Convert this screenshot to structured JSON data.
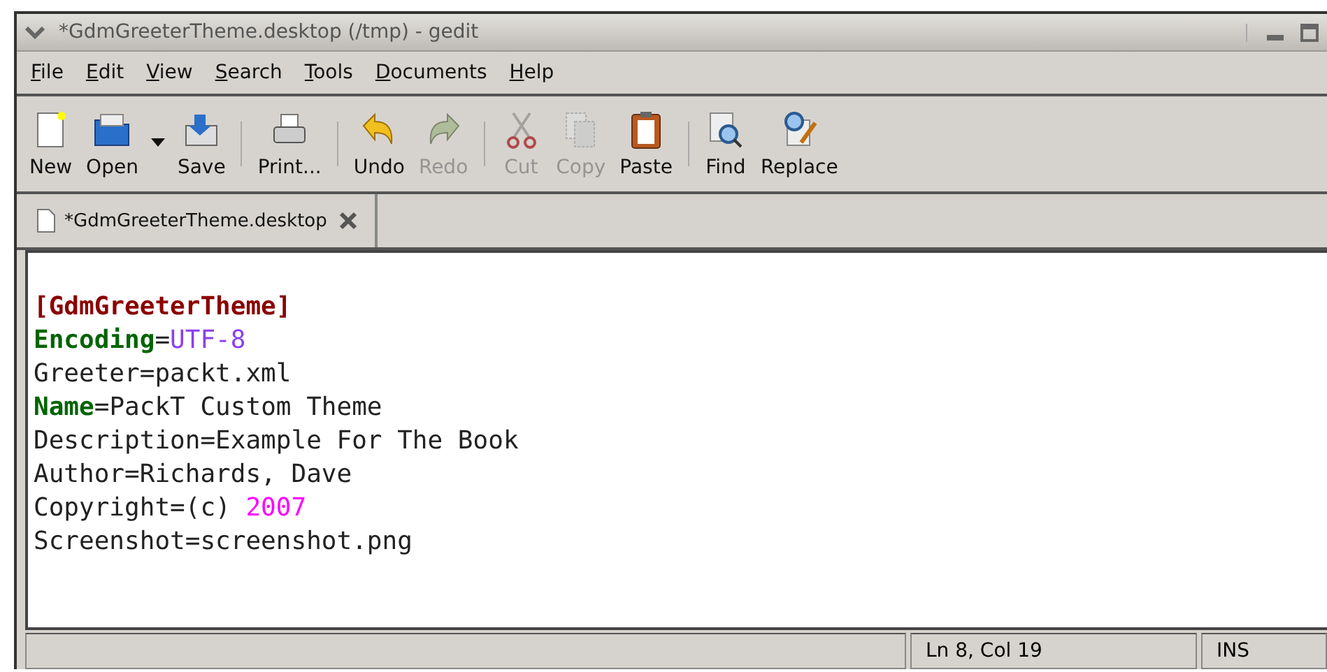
{
  "window": {
    "title": "*GdmGreeterTheme.desktop (/tmp) - gedit"
  },
  "menu": [
    "File",
    "Edit",
    "View",
    "Search",
    "Tools",
    "Documents",
    "Help"
  ],
  "toolbar": [
    [
      {
        "kind": "new",
        "label": "New",
        "disabled": false
      },
      {
        "kind": "open",
        "label": "Open",
        "disabled": false,
        "dropdown": true
      },
      {
        "kind": "save",
        "label": "Save",
        "disabled": false
      }
    ],
    [
      {
        "kind": "print",
        "label": "Print...",
        "disabled": false
      }
    ],
    [
      {
        "kind": "undo",
        "label": "Undo",
        "disabled": false
      },
      {
        "kind": "redo",
        "label": "Redo",
        "disabled": true
      }
    ],
    [
      {
        "kind": "cut",
        "label": "Cut",
        "disabled": true
      },
      {
        "kind": "copy",
        "label": "Copy",
        "disabled": true
      },
      {
        "kind": "paste",
        "label": "Paste",
        "disabled": false
      }
    ],
    [
      {
        "kind": "find",
        "label": "Find",
        "disabled": false
      },
      {
        "kind": "replace",
        "label": "Replace",
        "disabled": false
      }
    ]
  ],
  "tabs": [
    {
      "label": "*GdmGreeterTheme.desktop",
      "selected": true
    }
  ],
  "editor": {
    "lines": [
      [
        {
          "kind": "section",
          "text": "[GdmGreeterTheme]"
        }
      ],
      [
        {
          "kind": "key",
          "text": "Encoding"
        },
        {
          "kind": "plain",
          "text": "="
        },
        {
          "kind": "value",
          "text": "UTF-8"
        }
      ],
      [
        {
          "kind": "plain",
          "text": "Greeter=packt.xml"
        }
      ],
      [
        {
          "kind": "key",
          "text": "Name"
        },
        {
          "kind": "plain",
          "text": "=PackT Custom Theme"
        }
      ],
      [
        {
          "kind": "plain",
          "text": "Description=Example For The Book"
        }
      ],
      [
        {
          "kind": "plain",
          "text": "Author=Richards, Dave"
        }
      ],
      [
        {
          "kind": "plain",
          "text": "Copyright=(c) "
        },
        {
          "kind": "number",
          "text": "2007"
        }
      ],
      [
        {
          "kind": "plain",
          "text": "Screenshot=screenshot.png"
        }
      ]
    ]
  },
  "status_bar": {
    "position": "Ln 8, Col 19",
    "mode": "INS"
  }
}
